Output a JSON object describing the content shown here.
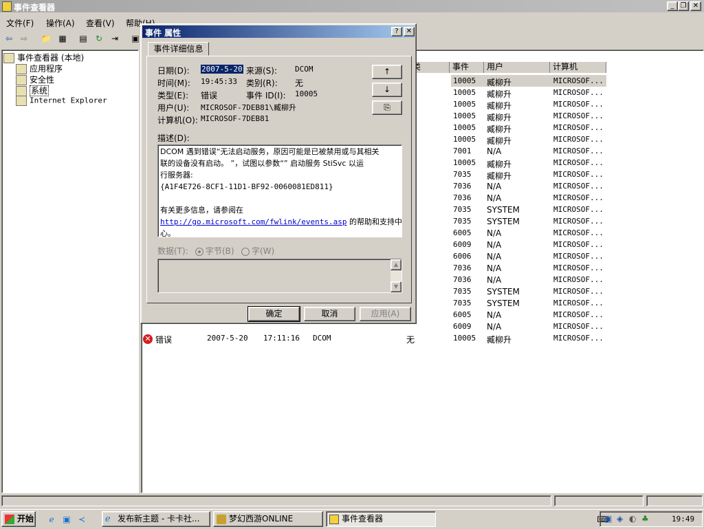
{
  "window": {
    "title": "事件查看器"
  },
  "menu": [
    "文件(F)",
    "操作(A)",
    "查看(V)",
    "帮助(H)"
  ],
  "tree": {
    "root": "事件查看器 (本地)",
    "items": [
      "应用程序",
      "安全性",
      "系统",
      "Internet Explorer"
    ]
  },
  "list": {
    "visible_headers": {
      "event": "事件",
      "user": "用户",
      "computer": "计算机",
      "type_partial": "类"
    },
    "rows": [
      {
        "event": "10005",
        "user": "臧柳升",
        "computer": "MICROSOF..."
      },
      {
        "event": "10005",
        "user": "臧柳升",
        "computer": "MICROSOF..."
      },
      {
        "event": "10005",
        "user": "臧柳升",
        "computer": "MICROSOF..."
      },
      {
        "event": "10005",
        "user": "臧柳升",
        "computer": "MICROSOF..."
      },
      {
        "event": "10005",
        "user": "臧柳升",
        "computer": "MICROSOF..."
      },
      {
        "event": "10005",
        "user": "臧柳升",
        "computer": "MICROSOF..."
      },
      {
        "event": "7001",
        "user": "N/A",
        "computer": "MICROSOF..."
      },
      {
        "event": "10005",
        "user": "臧柳升",
        "computer": "MICROSOF..."
      },
      {
        "event": "7035",
        "user": "臧柳升",
        "computer": "MICROSOF..."
      },
      {
        "event": "7036",
        "user": "N/A",
        "computer": "MICROSOF..."
      },
      {
        "event": "7036",
        "user": "N/A",
        "computer": "MICROSOF..."
      },
      {
        "event": "7035",
        "user": "SYSTEM",
        "computer": "MICROSOF..."
      },
      {
        "event": "7035",
        "user": "SYSTEM",
        "computer": "MICROSOF..."
      },
      {
        "event": "6005",
        "user": "N/A",
        "computer": "MICROSOF..."
      },
      {
        "event": "6009",
        "user": "N/A",
        "computer": "MICROSOF..."
      },
      {
        "event": "6006",
        "user": "N/A",
        "computer": "MICROSOF..."
      },
      {
        "event": "7036",
        "user": "N/A",
        "computer": "MICROSOF..."
      },
      {
        "event": "7036",
        "user": "N/A",
        "computer": "MICROSOF..."
      },
      {
        "event": "7035",
        "user": "SYSTEM",
        "computer": "MICROSOF..."
      },
      {
        "event": "7035",
        "user": "SYSTEM",
        "computer": "MICROSOF..."
      },
      {
        "event": "6005",
        "user": "N/A",
        "computer": "MICROSOF..."
      },
      {
        "event": "6009",
        "user": "N/A",
        "computer": "MICROSOF..."
      }
    ],
    "last_row": {
      "type": "错误",
      "date": "2007-5-20",
      "time": "17:11:16",
      "source": "DCOM",
      "category": "无",
      "event": "10005",
      "user": "臧柳升",
      "computer": "MICROSOF..."
    }
  },
  "dialog": {
    "title": "事件 属性",
    "tab": "事件详细信息",
    "labels": {
      "date": "日期(D):",
      "source": "来源(S):",
      "time": "时间(M):",
      "category": "类别(R):",
      "type": "类型(E):",
      "event_id": "事件 ID(I):",
      "user": "用户(U):",
      "computer": "计算机(O):",
      "description": "描述(D):",
      "data": "数据(T):",
      "bytes": "字节(B)",
      "words": "字(W)"
    },
    "values": {
      "date": "2007-5-20",
      "source": "DCOM",
      "time": "19:45:33",
      "category": "无",
      "type": "错误",
      "event_id": "10005",
      "user": "MICROSOF-7DEB81\\臧柳升",
      "computer": "MICROSOF-7DEB81"
    },
    "description_lines": [
      "DCOM 遇到错误“无法启动服务，原因可能是已被禁用或与其相关",
      "联的设备没有启动。 ”，试图以参数“” 启动服务 StiSvc 以运",
      "行服务器:",
      "{A1F4E726-8CF1-11D1-BF92-0060081ED811}",
      "",
      "有关更多信息，请参阅在"
    ],
    "link": "http://go.microsoft.com/fwlink/events.asp",
    "after_link": " 的帮助和支持中",
    "last_line": "心。",
    "buttons": {
      "ok": "确定",
      "cancel": "取消",
      "apply": "应用(A)"
    },
    "nav": {
      "up": "↑",
      "down": "↓",
      "copy": "⎘"
    }
  },
  "taskbar": {
    "start": "开始",
    "tasks": [
      "发布新主题 - 卡卡社...",
      "梦幻西游ONLINE",
      "事件查看器"
    ],
    "clock": "19:49"
  }
}
